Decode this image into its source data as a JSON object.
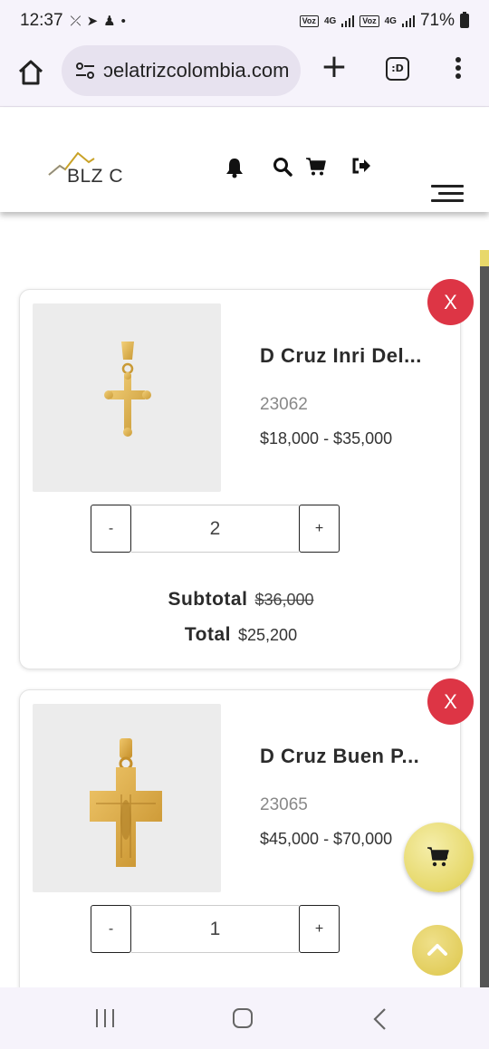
{
  "status_bar": {
    "time": "12:37",
    "battery": "71%",
    "network_1": "4G",
    "network_2": "4G"
  },
  "browser": {
    "url": "ɔelatrizcolombia.com",
    "tab_button_label": ":D"
  },
  "site_header": {
    "logo_text": "BLZ C"
  },
  "cart_items": [
    {
      "name": "D Cruz Inri Del...",
      "code": "23062",
      "price_range": "$18,000 - $35,000",
      "quantity": "2",
      "minus_label": "-",
      "plus_label": "+",
      "remove_label": "X",
      "subtotal_label": "Subtotal",
      "subtotal_value": "$36,000",
      "total_label": "Total",
      "total_value": "$25,200"
    },
    {
      "name": "D Cruz Buen P...",
      "code": "23065",
      "price_range": "$45,000 - $70,000",
      "quantity": "1",
      "minus_label": "-",
      "plus_label": "+",
      "remove_label": "X"
    }
  ],
  "colors": {
    "remove_red": "#dd3545",
    "gold_accent": "#e6d86a",
    "browser_chrome": "#f6f3fb"
  }
}
